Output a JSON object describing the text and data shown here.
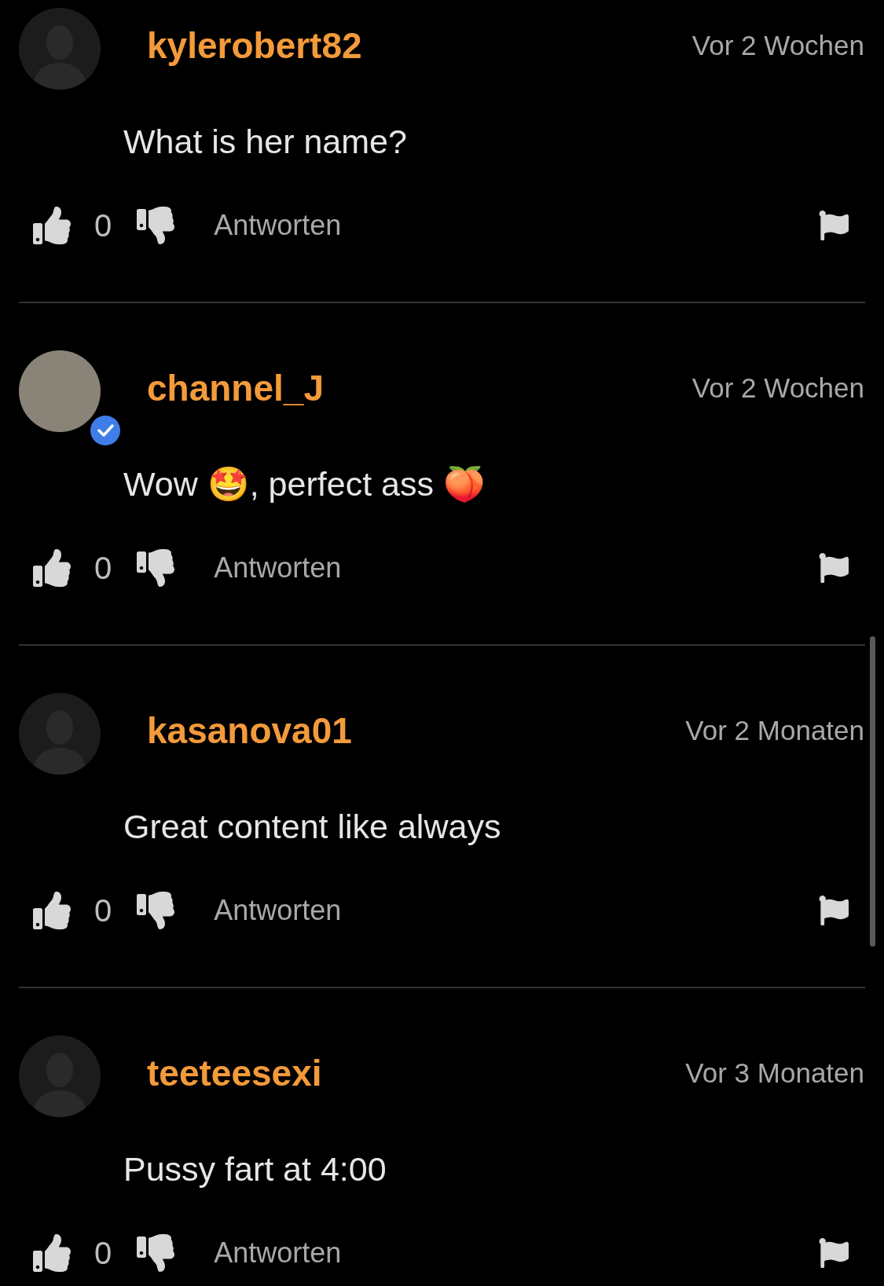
{
  "comments": [
    {
      "username": "kylerobert82",
      "time": "Vor 2 Wochen",
      "avatar": {
        "kind": "default",
        "verified": false
      },
      "text": "What is her name?",
      "likes": "0",
      "reply": "Antworten"
    },
    {
      "username": "channel_J",
      "time": "Vor 2 Wochen",
      "avatar": {
        "kind": "photo",
        "verified": true
      },
      "text": "Wow 🤩, perfect ass 🍑",
      "likes": "0",
      "reply": "Antworten"
    },
    {
      "username": "kasanova01",
      "time": "Vor 2 Monaten",
      "avatar": {
        "kind": "default",
        "verified": false
      },
      "text": "Great content like always",
      "likes": "0",
      "reply": "Antworten"
    },
    {
      "username": "teeteesexi",
      "time": "Vor 3 Monaten",
      "avatar": {
        "kind": "default",
        "verified": false
      },
      "text": "Pussy fart at 4:00",
      "likes": "0",
      "reply": "Antworten"
    }
  ]
}
